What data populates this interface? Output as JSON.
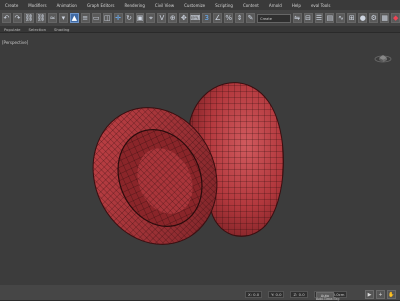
{
  "menu": [
    "Create",
    "Modifiers",
    "Animation",
    "Graph Editors",
    "Rendering",
    "Civil View",
    "Customize",
    "Scripting",
    "Content",
    "Arnold",
    "Help",
    "eval Tools"
  ],
  "toolbar": {
    "selection_set_label": "Create Selection Se"
  },
  "ribbon": {
    "items": [
      "Populate",
      "Selection",
      "Shading"
    ]
  },
  "viewport": {
    "label": "[Perspective]"
  },
  "status": {
    "x": "X: 0.0",
    "y": "Y: 0.0",
    "z": "Z: 0.0",
    "grid": "Grid = 10.0cm",
    "auto_key": "Auto",
    "set_tags": "Add Time Tag"
  },
  "colors": {
    "model": "#b2383d",
    "wire": "#2a0b0c",
    "viewport_bg": "#3c3c3c"
  }
}
